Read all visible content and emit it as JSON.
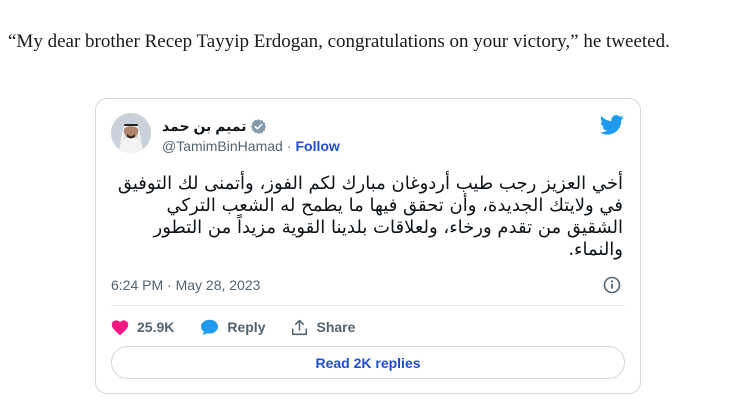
{
  "article": {
    "text": "“My dear brother Recep Tayyip Erdogan, congratulations on your victory,” he tweeted."
  },
  "tweet": {
    "author": {
      "display_name": "تميم بن حمد",
      "handle": "@TamimBinHamad",
      "separator": "·",
      "follow_label": "Follow"
    },
    "text": "أخي العزيز رجب طيب أردوغان مبارك لكم الفوز، وأتمنى لك التوفيق في ولايتك الجديدة، وأن تحقق فيها ما يطمح له الشعب التركي الشقيق من تقدم ورخاء، ولعلاقات بلدينا القوية مزيداً من التطور والنماء.",
    "timestamp": "6:24 PM · May 28, 2023",
    "likes": "25.9K",
    "reply_label": "Reply",
    "share_label": "Share",
    "read_replies_label": "Read 2K replies"
  },
  "colors": {
    "accent_blue": "#1d9bf0",
    "link_blue": "#1d4ed8",
    "like_pink": "#f91880",
    "muted_gray": "#536471"
  },
  "icons": {
    "brand": "twitter-bird-icon",
    "verified": "verified-badge-icon",
    "info": "info-icon",
    "like": "heart-icon",
    "reply": "speech-bubble-icon",
    "share": "upload-arrow-icon"
  }
}
